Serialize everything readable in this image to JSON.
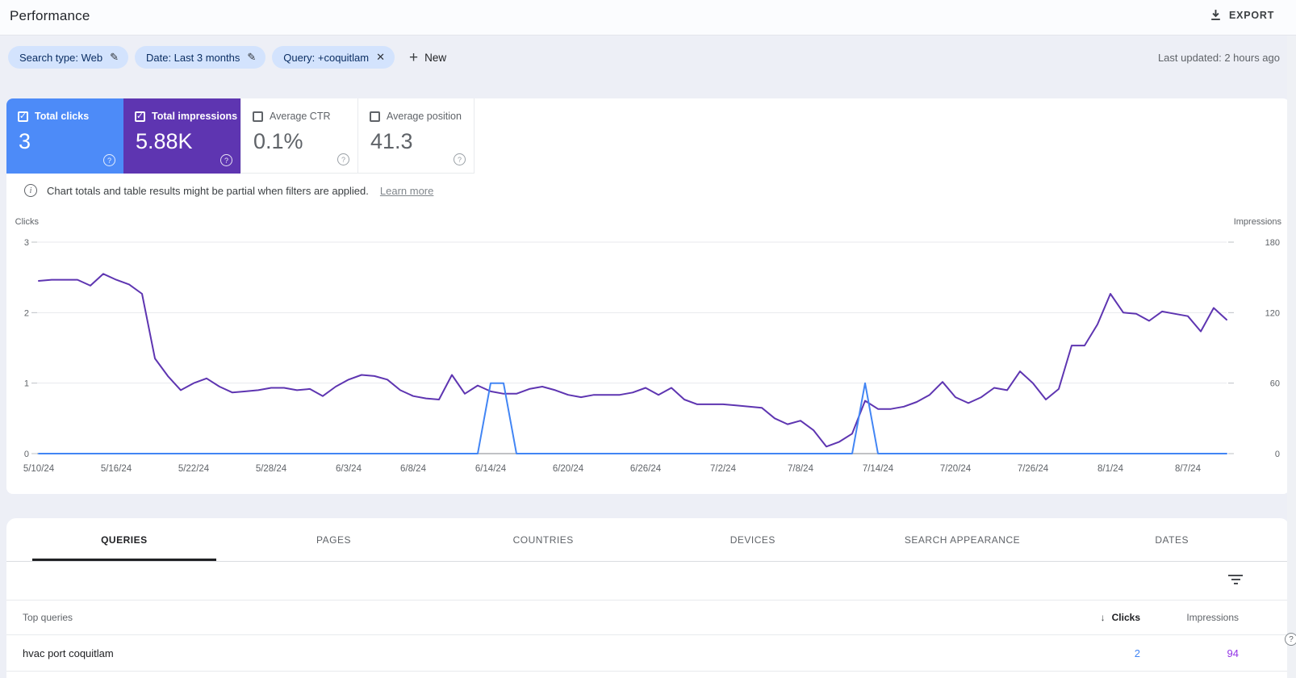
{
  "icons": {
    "check": "✓",
    "close": "✕",
    "pencil": "✎",
    "plus": "+",
    "sort_desc": "↓",
    "question": "?",
    "info": "i"
  },
  "header": {
    "title": "Performance",
    "export_label": "EXPORT"
  },
  "filters": {
    "chips": [
      {
        "label": "Search type: Web",
        "action": "edit"
      },
      {
        "label": "Date: Last 3 months",
        "action": "edit"
      },
      {
        "label": "Query: +coquitlam",
        "action": "remove"
      }
    ],
    "new_label": "New",
    "last_updated": "Last updated: 2 hours ago"
  },
  "metrics": [
    {
      "label": "Total clicks",
      "value": "3",
      "checked": true,
      "color": "#4d8bf8"
    },
    {
      "label": "Total impressions",
      "value": "5.88K",
      "checked": true,
      "color": "#5e35b1"
    },
    {
      "label": "Average CTR",
      "value": "0.1%",
      "checked": false,
      "color": "#ffffff"
    },
    {
      "label": "Average position",
      "value": "41.3",
      "checked": false,
      "color": "#ffffff"
    }
  ],
  "notice": {
    "text": "Chart totals and table results might be partial when filters are applied.",
    "link": "Learn more"
  },
  "chart_data": {
    "type": "line",
    "title": "",
    "grid": true,
    "legend": "none",
    "left_axis": {
      "label": "Clicks",
      "max": 3,
      "ticks": [
        0,
        1,
        2,
        3
      ]
    },
    "right_axis": {
      "label": "Impressions",
      "max": 180,
      "ticks": [
        0,
        60,
        120,
        180
      ]
    },
    "x_ticks": [
      {
        "label": "5/10/24",
        "day": 0
      },
      {
        "label": "5/16/24",
        "day": 6
      },
      {
        "label": "5/22/24",
        "day": 12
      },
      {
        "label": "5/28/24",
        "day": 18
      },
      {
        "label": "6/3/24",
        "day": 24
      },
      {
        "label": "6/8/24",
        "day": 29
      },
      {
        "label": "6/14/24",
        "day": 35
      },
      {
        "label": "6/20/24",
        "day": 41
      },
      {
        "label": "6/26/24",
        "day": 47
      },
      {
        "label": "7/2/24",
        "day": 53
      },
      {
        "label": "7/8/24",
        "day": 59
      },
      {
        "label": "7/14/24",
        "day": 65
      },
      {
        "label": "7/20/24",
        "day": 71
      },
      {
        "label": "7/26/24",
        "day": 77
      },
      {
        "label": "8/1/24",
        "day": 83
      },
      {
        "label": "8/7/24",
        "day": 89
      }
    ],
    "x": [
      "5/10/24",
      "5/11/24",
      "5/12/24",
      "5/13/24",
      "5/14/24",
      "5/15/24",
      "5/16/24",
      "5/17/24",
      "5/18/24",
      "5/19/24",
      "5/20/24",
      "5/21/24",
      "5/22/24",
      "5/23/24",
      "5/24/24",
      "5/25/24",
      "5/26/24",
      "5/27/24",
      "5/28/24",
      "5/29/24",
      "5/30/24",
      "5/31/24",
      "6/1/24",
      "6/2/24",
      "6/3/24",
      "6/4/24",
      "6/5/24",
      "6/6/24",
      "6/7/24",
      "6/8/24",
      "6/9/24",
      "6/10/24",
      "6/11/24",
      "6/12/24",
      "6/13/24",
      "6/14/24",
      "6/15/24",
      "6/16/24",
      "6/17/24",
      "6/18/24",
      "6/19/24",
      "6/20/24",
      "6/21/24",
      "6/22/24",
      "6/23/24",
      "6/24/24",
      "6/25/24",
      "6/26/24",
      "6/27/24",
      "6/28/24",
      "6/29/24",
      "6/30/24",
      "7/1/24",
      "7/2/24",
      "7/3/24",
      "7/4/24",
      "7/5/24",
      "7/6/24",
      "7/7/24",
      "7/8/24",
      "7/9/24",
      "7/10/24",
      "7/11/24",
      "7/12/24",
      "7/13/24",
      "7/14/24",
      "7/15/24",
      "7/16/24",
      "7/17/24",
      "7/18/24",
      "7/19/24",
      "7/20/24",
      "7/21/24",
      "7/22/24",
      "7/23/24",
      "7/24/24",
      "7/25/24",
      "7/26/24",
      "7/27/24",
      "7/28/24",
      "7/29/24",
      "7/30/24",
      "7/31/24",
      "8/1/24",
      "8/2/24",
      "8/3/24",
      "8/4/24",
      "8/5/24",
      "8/6/24",
      "8/7/24",
      "8/8/24",
      "8/9/24",
      "8/10/24"
    ],
    "series": [
      {
        "name": "Clicks",
        "axis": "left",
        "color": "#4285f4",
        "values": [
          0,
          0,
          0,
          0,
          0,
          0,
          0,
          0,
          0,
          0,
          0,
          0,
          0,
          0,
          0,
          0,
          0,
          0,
          0,
          0,
          0,
          0,
          0,
          0,
          0,
          0,
          0,
          0,
          0,
          0,
          0,
          0,
          0,
          0,
          0,
          1,
          1,
          0,
          0,
          0,
          0,
          0,
          0,
          0,
          0,
          0,
          0,
          0,
          0,
          0,
          0,
          0,
          0,
          0,
          0,
          0,
          0,
          0,
          0,
          0,
          0,
          0,
          0,
          0,
          1,
          0,
          0,
          0,
          0,
          0,
          0,
          0,
          0,
          0,
          0,
          0,
          0,
          0,
          0,
          0,
          0,
          0,
          0,
          0,
          0,
          0,
          0,
          0,
          0,
          0,
          0,
          0,
          0
        ]
      },
      {
        "name": "Impressions",
        "axis": "right",
        "color": "#5e35b1",
        "values": [
          147,
          148,
          148,
          148,
          143,
          153,
          148,
          144,
          136,
          81,
          66,
          54,
          60,
          64,
          57,
          52,
          53,
          54,
          56,
          56,
          54,
          55,
          49,
          57,
          63,
          67,
          66,
          63,
          54,
          49,
          47,
          46,
          67,
          51,
          58,
          53,
          51,
          51,
          55,
          57,
          54,
          50,
          48,
          50,
          50,
          50,
          52,
          56,
          50,
          56,
          46,
          42,
          42,
          42,
          41,
          40,
          39,
          30,
          25,
          28,
          20,
          6,
          10,
          17,
          45,
          38,
          38,
          40,
          44,
          50,
          61,
          48,
          43,
          48,
          56,
          54,
          70,
          60,
          46,
          55,
          92,
          92,
          110,
          136,
          120,
          119,
          113,
          121,
          119,
          117,
          104,
          124,
          114
        ]
      }
    ]
  },
  "tabs": {
    "items": [
      "QUERIES",
      "PAGES",
      "COUNTRIES",
      "DEVICES",
      "SEARCH APPEARANCE",
      "DATES"
    ],
    "active": "QUERIES"
  },
  "table": {
    "first_col_header": "Top queries",
    "clicks_header": "Clicks",
    "impressions_header": "Impressions",
    "rows": [
      {
        "query": "hvac port coquitlam",
        "clicks": "2",
        "impressions": "94"
      }
    ]
  }
}
